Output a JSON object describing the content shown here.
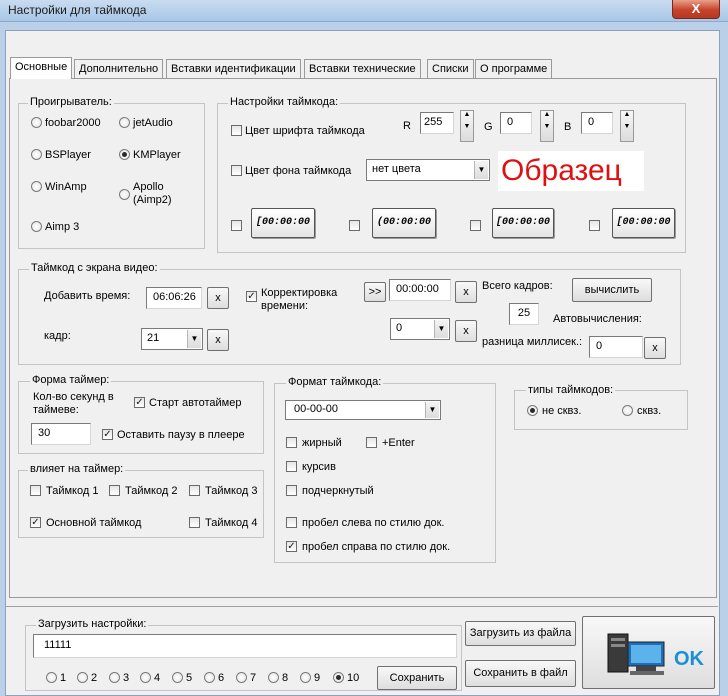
{
  "window": {
    "title": "Настройки для  таймкода",
    "close_label": "X"
  },
  "tabs": [
    "Основные",
    "Дополнительно",
    "Вставки идентификации",
    "Вставки технические",
    "Списки",
    "О программе"
  ],
  "player": {
    "label": "Проигрыватель:",
    "options": [
      {
        "label": "foobar2000",
        "selected": false
      },
      {
        "label": "jetAudio",
        "selected": false
      },
      {
        "label": "BSPlayer",
        "selected": false
      },
      {
        "label": "KMPlayer",
        "selected": true
      },
      {
        "label": "WinAmp",
        "selected": false
      },
      {
        "label": "Apollo\n(Aimp2)",
        "selected": false
      },
      {
        "label": "Aimp 3",
        "selected": false
      }
    ]
  },
  "tc_settings": {
    "label": "Настройки таймкода:",
    "font_color_label": "Цвет шрифта таймкода",
    "bg_color_label": "Цвет фона таймкода",
    "bg_color_value": "нет цвета",
    "r_label": "R",
    "r_value": "255",
    "g_label": "G",
    "g_value": "0",
    "b_label": "B",
    "b_value": "0",
    "sample": "Образец",
    "samples": [
      "[00:00:00",
      "(00:00:00",
      "[00:00:00",
      "[00:00:00"
    ]
  },
  "screen_tc": {
    "label": "Таймкод с экрана видео:",
    "add_time_label": "Добавить время:",
    "add_time_value": "06:06:26",
    "frame_label": "кадр:",
    "frame_value": "21",
    "correction_label": "Корректировка\nвремени:",
    "shift_button": ">>",
    "correction_value": "00:00:00",
    "correction_frames": "0",
    "clear_label": "x",
    "total_frames_label": "Всего кадров:",
    "total_frames_value": "25",
    "calc_button": "вычислить",
    "autocalc_label": "Автовычисления:",
    "ms_diff_label": "разница миллисек.:",
    "ms_diff_value": "0"
  },
  "timer_form": {
    "label": "Форма таймер:",
    "seconds_label": "Кол-во секунд в\nтаймеве:",
    "seconds_value": "30",
    "autostart_label": "Старт автотаймер",
    "pause_label": "Оставить паузу в плеере"
  },
  "affects": {
    "label": "влияет на таймер:",
    "tc1": "Таймкод 1",
    "tc2": "Таймкод 2",
    "tc3": "Таймкод 3",
    "main": "Основной таймкод",
    "tc4": "Таймкод 4"
  },
  "format": {
    "label": "Формат таймкода:",
    "value": "00-00-00",
    "bold": "жирный",
    "enter": "+Enter",
    "italic": "курсив",
    "underline": "подчеркнутый",
    "space_left": "пробел слева по стилю док.",
    "space_right": "пробел справа по стилю док."
  },
  "tc_types": {
    "label": "типы таймкодов:",
    "non_seq": "не сквз.",
    "seq": "сквз."
  },
  "load": {
    "label": "Загрузить настройки:",
    "value": "11111",
    "slots": [
      "1",
      "2",
      "3",
      "4",
      "5",
      "6",
      "7",
      "8",
      "9",
      "10"
    ],
    "save_button": "Сохранить",
    "load_file_button": "Загрузить из файла",
    "save_file_button": "Сохранить в файл",
    "ok_label": "OK"
  },
  "colors": {
    "sample_red": "#e01010",
    "ok_blue": "#1a8fd8"
  }
}
